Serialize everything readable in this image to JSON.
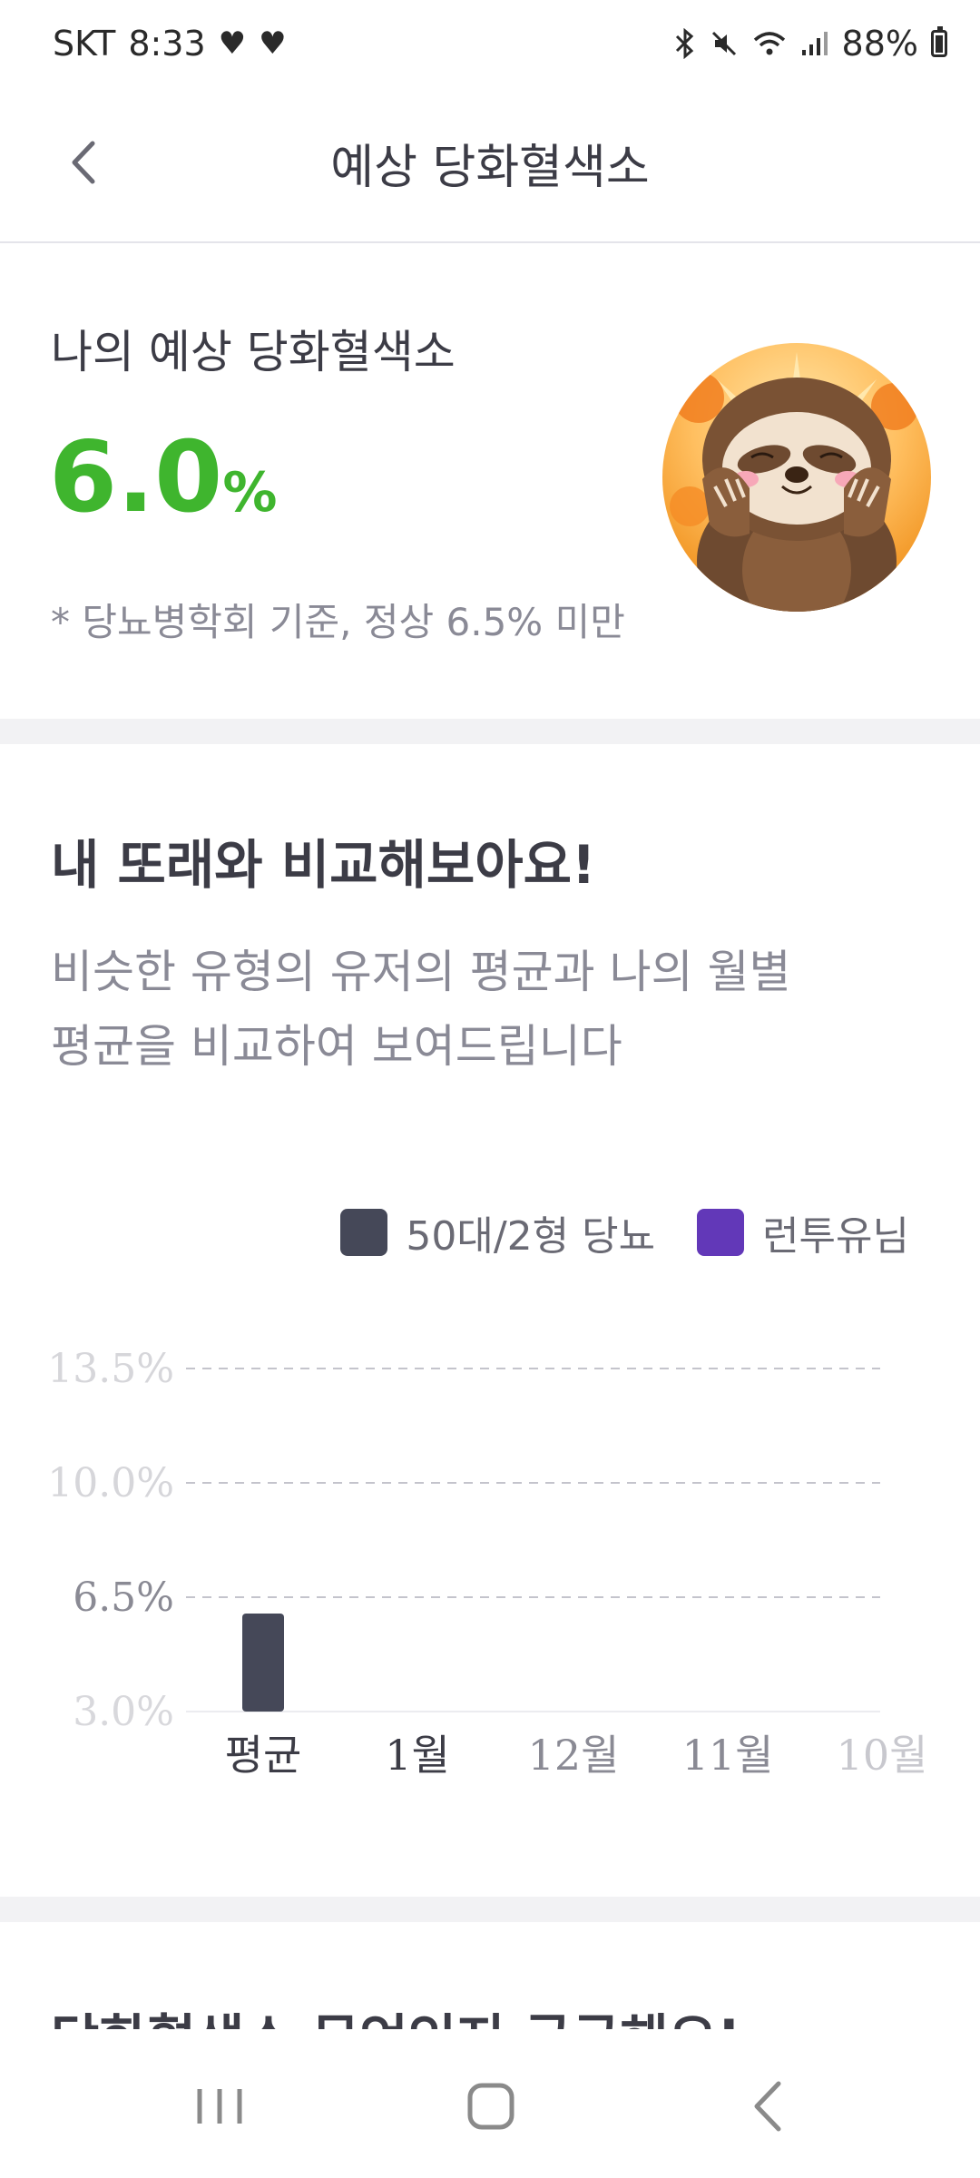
{
  "status_bar": {
    "carrier": "SKT",
    "time": "8:33",
    "battery": "88%"
  },
  "header": {
    "title": "예상 당화혈색소"
  },
  "summary": {
    "label": "나의 예상 당화혈색소",
    "value": "6.0",
    "unit": "%",
    "criteria": "* 당뇨병학회 기준, 정상 6.5% 미만",
    "value_color": "#3fb52e"
  },
  "compare": {
    "title": "내 또래와 비교해보아요!",
    "description_line1": "비슷한 유형의 유저의 평균과 나의 월별",
    "description_line2": "평균을 비교하여 보여드립니다"
  },
  "legend": {
    "peer_label": "50대/2형 당뇨",
    "peer_color": "#454858",
    "me_label": "런투유님",
    "me_color": "#6238b8"
  },
  "chart_data": {
    "type": "bar",
    "categories": [
      "평균",
      "1월",
      "12월",
      "11월",
      "10월"
    ],
    "series": [
      {
        "name": "50대/2형 당뇨",
        "values": [
          6.0,
          null,
          null,
          null,
          null
        ]
      },
      {
        "name": "런투유님",
        "values": [
          null,
          null,
          null,
          null,
          null
        ]
      }
    ],
    "yticks": [
      "3.0%",
      "6.5%",
      "10.0%",
      "13.5%"
    ],
    "ylim": [
      3.0,
      13.5
    ],
    "grid": true,
    "legend": "top-right"
  },
  "next_section": {
    "title": "당화혈색소 무엇인지 궁금해요!"
  }
}
